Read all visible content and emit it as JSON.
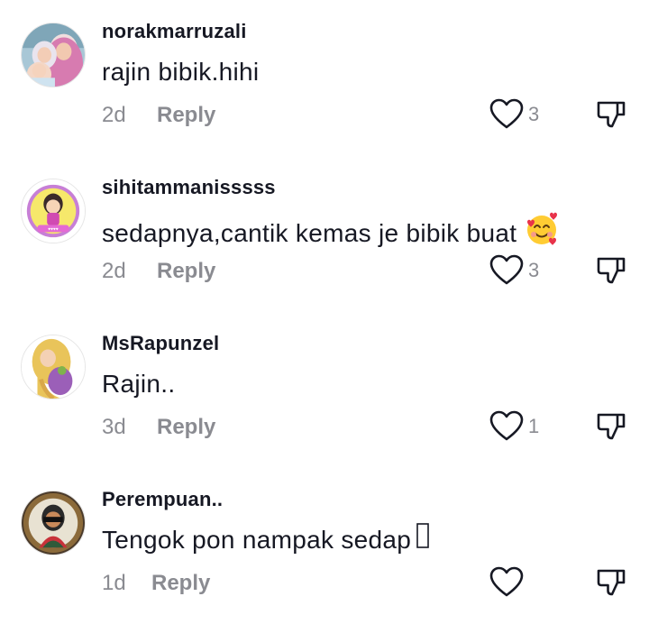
{
  "comments": [
    {
      "username": "norakmarruzali",
      "text": "rajin bibik.hihi",
      "time": "2d",
      "reply": "Reply",
      "likes": "3"
    },
    {
      "username": "sihitammanisssss",
      "text": "sedapnya,cantik kemas je bibik buat",
      "emoji": "smiling-face-with-hearts",
      "time": "2d",
      "reply": "Reply",
      "likes": "3"
    },
    {
      "username": "MsRapunzel",
      "text": "Rajin..",
      "time": "3d",
      "reply": "Reply",
      "likes": "1"
    },
    {
      "username": "Perempuan..",
      "text": "Tengok pon nampak sedap",
      "time": "1d",
      "reply": "Reply",
      "likes": ""
    }
  ],
  "colors": {
    "text": "#161823",
    "muted": "#8a8b91"
  },
  "icons": [
    "heart-icon",
    "dislike-icon",
    "smiling-face-with-hearts-icon",
    "missing-glyph-box"
  ]
}
